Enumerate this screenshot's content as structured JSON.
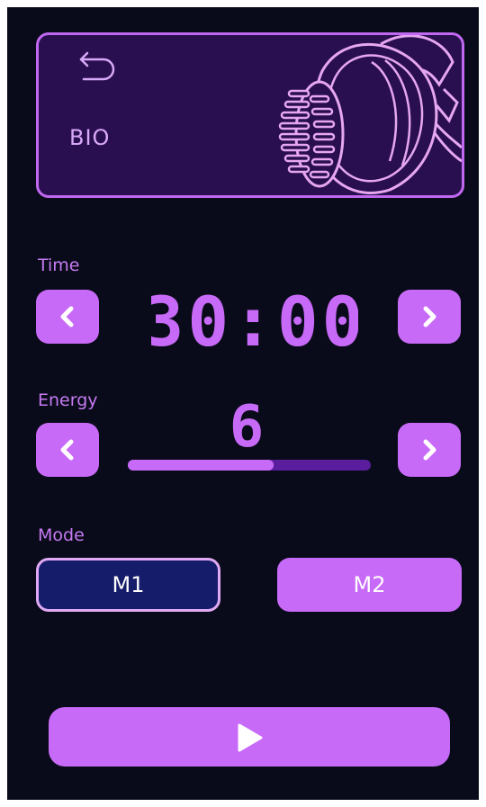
{
  "theme": {
    "background": "#090b1a",
    "accent": "#c86af8",
    "card": "#2a0f50",
    "selected_mode": "#151d6a"
  },
  "header": {
    "title": "BIO",
    "back_icon": "back-arrow-icon",
    "illustration": "massage-brush-device"
  },
  "time": {
    "label": "Time",
    "value": "30:00",
    "decrease_icon": "chevron-left-icon",
    "increase_icon": "chevron-right-icon"
  },
  "energy": {
    "label": "Energy",
    "value": "6",
    "level_fraction": 0.6
  },
  "mode": {
    "label": "Mode",
    "options": [
      "M1",
      "M2"
    ],
    "selected": "M1"
  },
  "play": {
    "icon": "play-icon"
  }
}
